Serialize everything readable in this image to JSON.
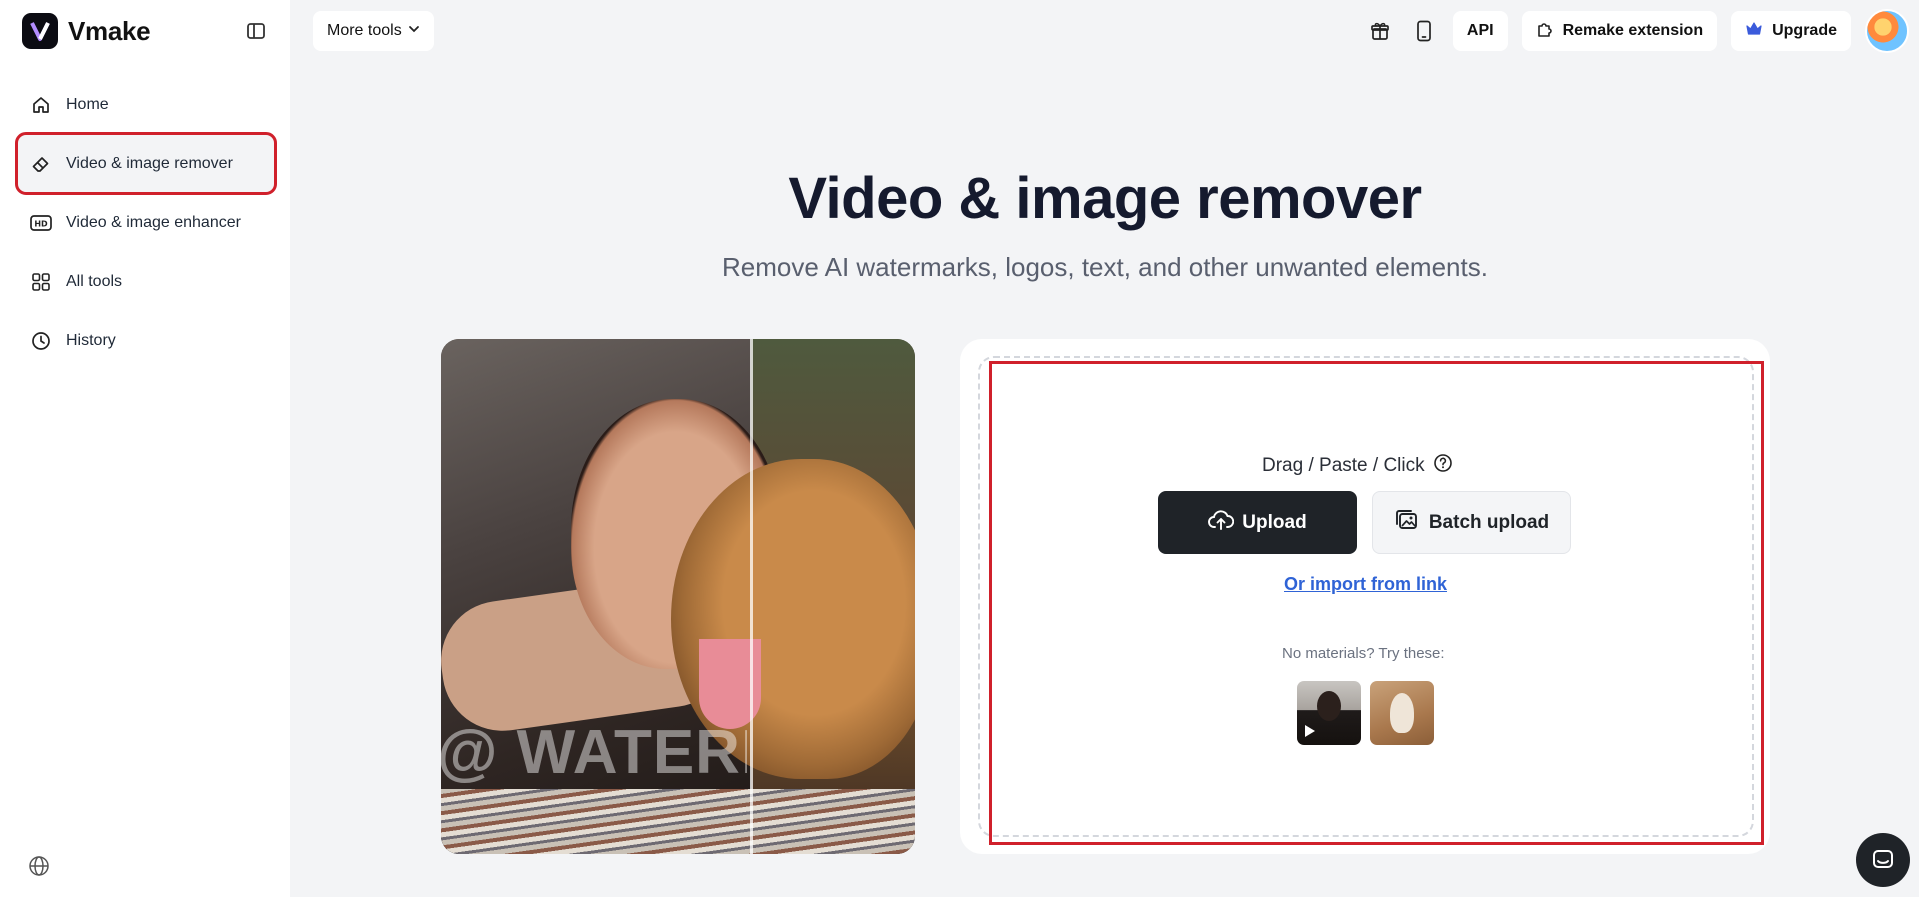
{
  "brand": {
    "name": "Vmake"
  },
  "sidebar": {
    "items": [
      {
        "label": "Home",
        "icon": "home-icon"
      },
      {
        "label": "Video & image remover",
        "icon": "eraser-icon",
        "active": true
      },
      {
        "label": "Video & image enhancer",
        "icon": "hd-icon"
      },
      {
        "label": "All tools",
        "icon": "grid-icon"
      },
      {
        "label": "History",
        "icon": "clock-icon"
      }
    ]
  },
  "topbar": {
    "more_tools": "More tools",
    "api": "API",
    "remake_extension": "Remake extension",
    "upgrade": "Upgrade"
  },
  "hero": {
    "title": "Video & image remover",
    "subtitle": "Remove AI watermarks, logos, text, and other unwanted elements."
  },
  "demo": {
    "watermark_text": "@ WATERI"
  },
  "upload": {
    "hint": "Drag / Paste / Click",
    "upload_label": "Upload",
    "batch_label": "Batch upload",
    "import_link": "Or import from link",
    "no_materials": "No materials? Try these:"
  },
  "colors": {
    "highlight": "#d0202b",
    "primary_button": "#1f2328",
    "link": "#2f63d6"
  }
}
